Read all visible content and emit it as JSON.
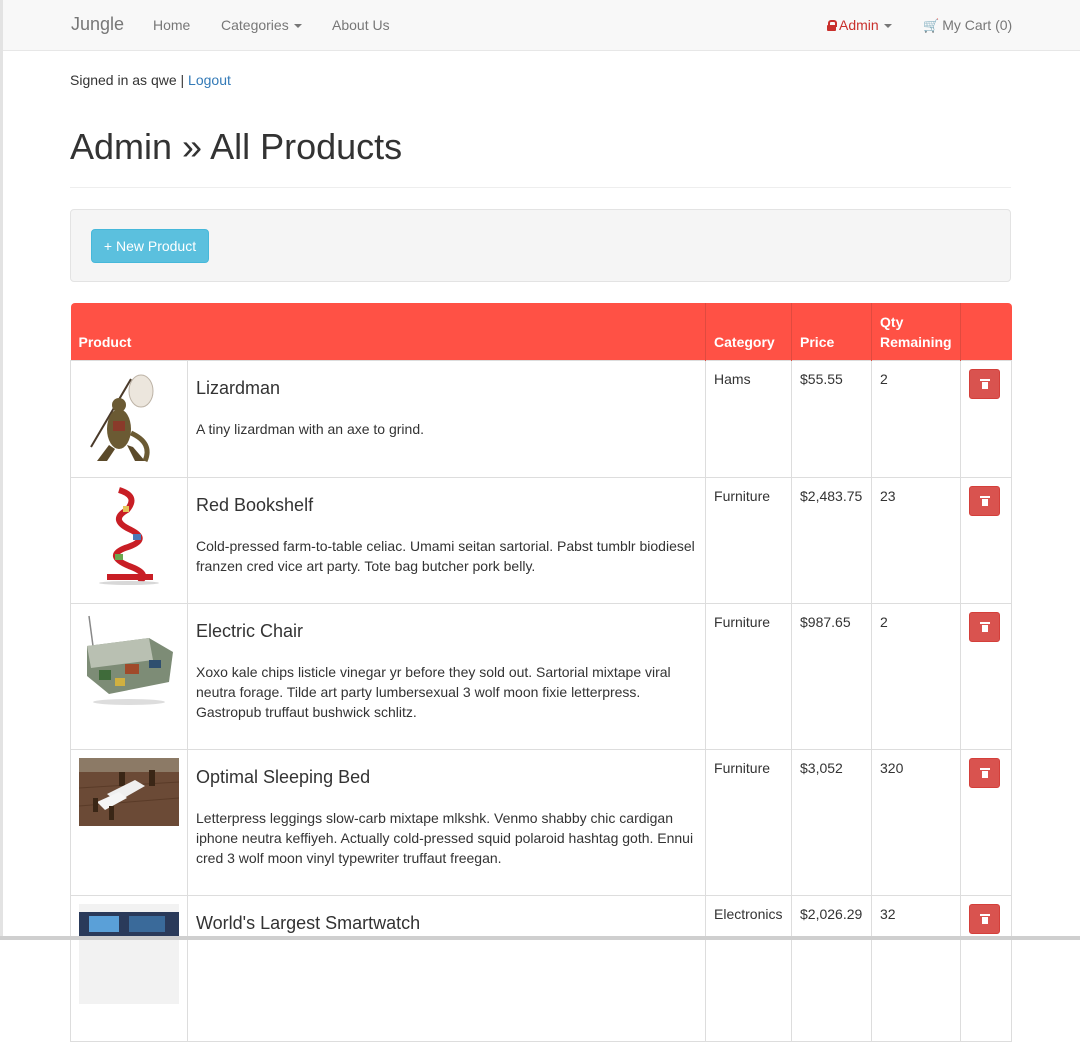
{
  "navbar": {
    "brand": "Jungle",
    "home": "Home",
    "categories": "Categories",
    "about": "About Us",
    "admin": "Admin",
    "cart": "My Cart (0)"
  },
  "session": {
    "signed_in_text": "Signed in as qwe |",
    "logout": "Logout"
  },
  "page": {
    "title": "Admin » All Products",
    "new_product_button": "+ New Product"
  },
  "colors": {
    "header_red": "#ff5145",
    "new_button": "#5bc0de",
    "delete_button": "#d9534f",
    "admin_red": "#c9302c",
    "link_blue": "#337ab7"
  },
  "table": {
    "headers": {
      "product": "Product",
      "category": "Category",
      "price": "Price",
      "qty": "Qty Remaining"
    },
    "rows": [
      {
        "name": "Lizardman",
        "description": "A tiny lizardman with an axe to grind.",
        "category": "Hams",
        "price": "$55.55",
        "qty": "2",
        "image_icon": "lizardman-image"
      },
      {
        "name": "Red Bookshelf",
        "description": "Cold-pressed farm-to-table celiac. Umami seitan sartorial. Pabst tumblr biodiesel franzen cred vice art party. Tote bag butcher pork belly.",
        "category": "Furniture",
        "price": "$2,483.75",
        "qty": "23",
        "image_icon": "red-bookshelf-image"
      },
      {
        "name": "Electric Chair",
        "description": "Xoxo kale chips listicle vinegar yr before they sold out. Sartorial mixtape viral neutra forage. Tilde art party lumbersexual 3 wolf moon fixie letterpress. Gastropub truffaut bushwick schlitz.",
        "category": "Furniture",
        "price": "$987.65",
        "qty": "2",
        "image_icon": "electric-chair-image"
      },
      {
        "name": "Optimal Sleeping Bed",
        "description": "Letterpress leggings slow-carb mixtape mlkshk. Venmo shabby chic cardigan iphone neutra keffiyeh. Actually cold-pressed squid polaroid hashtag goth. Ennui cred 3 wolf moon vinyl typewriter truffaut freegan.",
        "category": "Furniture",
        "price": "$3,052",
        "qty": "320",
        "image_icon": "bed-image"
      },
      {
        "name": "World's Largest Smartwatch",
        "description": "",
        "category": "Electronics",
        "price": "$2,026.29",
        "qty": "32",
        "image_icon": "smartwatch-image"
      }
    ]
  }
}
